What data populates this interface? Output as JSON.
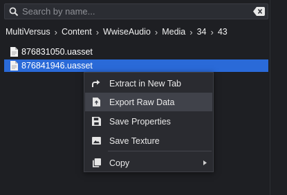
{
  "search": {
    "placeholder": "Search by name...",
    "value": ""
  },
  "breadcrumb": [
    "MultiVersus",
    "Content",
    "WwiseAudio",
    "Media",
    "34",
    "43"
  ],
  "files": [
    {
      "name": "876831050.uasset",
      "selected": false
    },
    {
      "name": "876841946.uasset",
      "selected": true
    }
  ],
  "context_menu": {
    "items": [
      {
        "label": "Extract in New Tab",
        "icon": "share-arrow-icon"
      },
      {
        "label": "Export Raw Data",
        "icon": "file-export-icon",
        "hovered": true
      },
      {
        "label": "Save Properties",
        "icon": "floppy-disk-icon"
      },
      {
        "label": "Save Texture",
        "icon": "image-icon"
      },
      {
        "label": "Copy",
        "icon": "copy-icon",
        "has_submenu": true
      }
    ]
  },
  "colors": {
    "background": "#1e1f23",
    "selection": "#2a6ad8",
    "menu": "#2a2b30",
    "menu_hover": "#40424a"
  }
}
